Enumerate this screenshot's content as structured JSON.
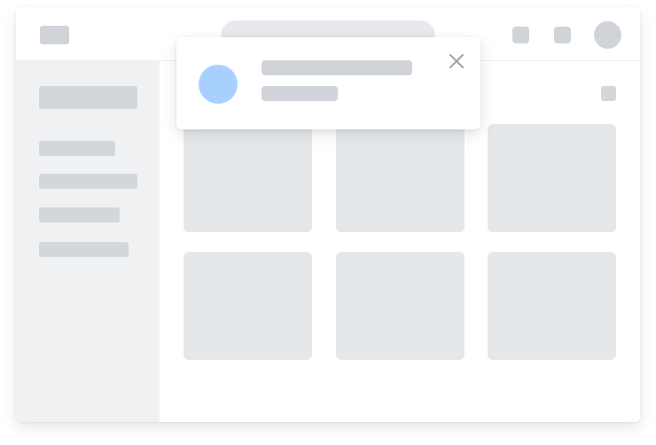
{
  "window": {},
  "topbar": {
    "icons": [
      "logo-placeholder",
      "notification-icon",
      "settings-icon",
      "avatar"
    ]
  },
  "sidebar": {
    "items": [
      "title-placeholder",
      "nav-placeholder-1",
      "nav-placeholder-2",
      "nav-placeholder-3",
      "nav-placeholder-4"
    ]
  },
  "main": {
    "cards": [
      "card-1",
      "card-2",
      "card-3",
      "card-4",
      "card-5",
      "card-6"
    ]
  },
  "toast": {
    "close_icon": "close-icon",
    "colors": {
      "avatar": "#a8d0ff",
      "placeholder": "#d0d4d9"
    }
  }
}
